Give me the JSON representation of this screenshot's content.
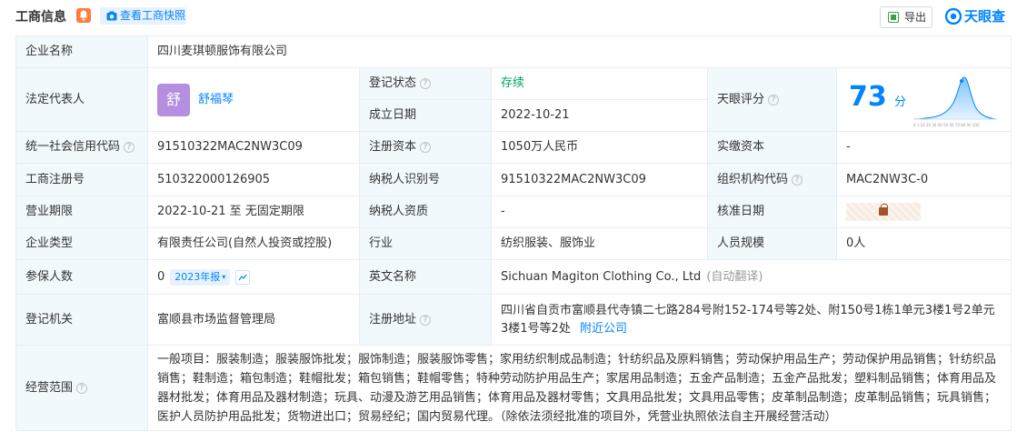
{
  "header": {
    "title": "工商信息",
    "snapshot_label": "查看工商快照",
    "export_label": "导出",
    "brand": "天眼查"
  },
  "company": {
    "name_label": "企业名称",
    "name": "四川麦琪顿服饰有限公司",
    "legal_rep_label": "法定代表人",
    "legal_rep_avatar": "舒",
    "legal_rep": "舒福琴",
    "reg_status_label": "登记状态",
    "reg_status": "存续",
    "found_date_label": "成立日期",
    "found_date": "2022-10-21",
    "score_label": "天眼评分",
    "score": "73",
    "score_unit": "分",
    "credit_code_label": "统一社会信用代码",
    "credit_code": "91510322MAC2NW3C09",
    "reg_capital_label": "注册资本",
    "reg_capital": "1050万人民币",
    "paid_capital_label": "实缴资本",
    "paid_capital": "-",
    "reg_no_label": "工商注册号",
    "reg_no": "510322000126905",
    "taxpayer_id_label": "纳税人识别号",
    "taxpayer_id": "91510322MAC2NW3C09",
    "org_code_label": "组织机构代码",
    "org_code": "MAC2NW3C-0",
    "term_label": "营业期限",
    "term": "2022-10-21 至 无固定期限",
    "taxpayer_qual_label": "纳税人资质",
    "taxpayer_qual": "-",
    "approve_date_label": "核准日期",
    "type_label": "企业类型",
    "type": "有限责任公司(自然人投资或控股)",
    "industry_label": "行业",
    "industry": "纺织服装、服饰业",
    "staff_label": "人员规模",
    "staff": "0人",
    "insured_label": "参保人数",
    "insured": "0",
    "insured_tag": "2023年报",
    "en_name_label": "英文名称",
    "en_name": "Sichuan Magiton Clothing Co., Ltd",
    "en_name_note": "(自动翻译)",
    "authority_label": "登记机关",
    "authority": "富顺县市场监督管理局",
    "address_label": "注册地址",
    "address": "四川省自贡市富顺县代寺镇二七路284号附152-174号等2处、附150号1栋1单元3楼1号2单元3楼1号等2处",
    "nearby_label": "附近公司",
    "scope_label": "经营范围",
    "scope": "一般项目：服装制造；服装服饰批发；服饰制造；服装服饰零售；家用纺织制成品制造；针纺织品及原料销售；劳动保护用品生产；劳动保护用品销售；针纺织品销售；鞋制造；箱包制造；鞋帽批发；箱包销售；鞋帽零售；特种劳动防护用品生产；家居用品制造；五金产品制造；五金产品批发；塑料制品销售；体育用品及器材批发；体育用品及器材制造；玩具、动漫及游艺用品销售；体育用品及器材零售；文具用品批发；文具用品零售；皮革制品制造；皮革制品销售；玩具销售；医护人员防护用品批发；货物进出口；贸易经纪；国内贸易代理。（除依法须经批准的项目外，凭营业执照依法自主开展经营活动）"
  },
  "colors": {
    "accent": "#0084ff",
    "status_green": "#00a35a",
    "label_bg": "#f2f9fc",
    "border": "#e4eef6"
  },
  "icons": {
    "bell": "bell-icon",
    "camera": "camera-icon",
    "excel": "excel-icon",
    "brand": "eye-logo-icon",
    "help": "question-circle-icon",
    "trend": "trend-chart-icon",
    "lock": "lock-icon"
  }
}
